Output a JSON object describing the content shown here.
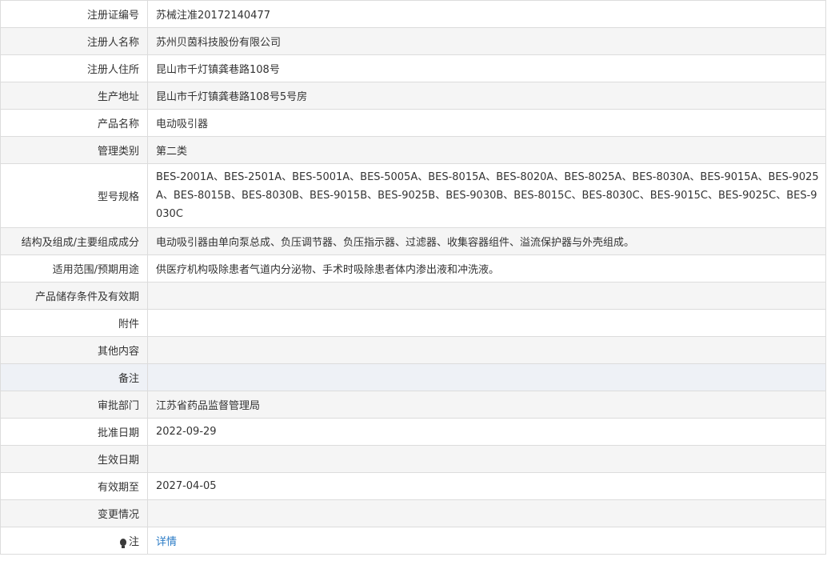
{
  "rows": [
    {
      "label": "注册证编号",
      "value": "苏械注准20172140477"
    },
    {
      "label": "注册人名称",
      "value": "苏州贝茵科技股份有限公司"
    },
    {
      "label": "注册人住所",
      "value": "昆山市千灯镇龚巷路108号"
    },
    {
      "label": "生产地址",
      "value": "昆山市千灯镇龚巷路108号5号房"
    },
    {
      "label": "产品名称",
      "value": "电动吸引器"
    },
    {
      "label": "管理类别",
      "value": "第二类"
    },
    {
      "label": "型号规格",
      "value": "BES-2001A、BES-2501A、BES-5001A、BES-5005A、BES-8015A、BES-8020A、BES-8025A、BES-8030A、BES-9015A、BES-9025A、BES-8015B、BES-8030B、BES-9015B、BES-9025B、BES-9030B、BES-8015C、BES-8030C、BES-9015C、BES-9025C、BES-9030C"
    },
    {
      "label": "结构及组成/主要组成成分",
      "value": "电动吸引器由单向泵总成、负压调节器、负压指示器、过滤器、收集容器组件、溢流保护器与外壳组成。"
    },
    {
      "label": "适用范围/预期用途",
      "value": "供医疗机构吸除患者气道内分泌物、手术时吸除患者体内渗出液和冲洗液。"
    },
    {
      "label": "产品储存条件及有效期",
      "value": ""
    },
    {
      "label": "附件",
      "value": ""
    },
    {
      "label": "其他内容",
      "value": ""
    },
    {
      "label": "备注",
      "value": ""
    },
    {
      "label": "审批部门",
      "value": "江苏省药品监督管理局"
    },
    {
      "label": "批准日期",
      "value": "2022-09-29"
    },
    {
      "label": "生效日期",
      "value": ""
    },
    {
      "label": "有效期至",
      "value": "2027-04-05"
    },
    {
      "label": "变更情况",
      "value": ""
    }
  ],
  "note": {
    "label": "注",
    "link": "详情",
    "icon": "lightbulb-icon"
  }
}
